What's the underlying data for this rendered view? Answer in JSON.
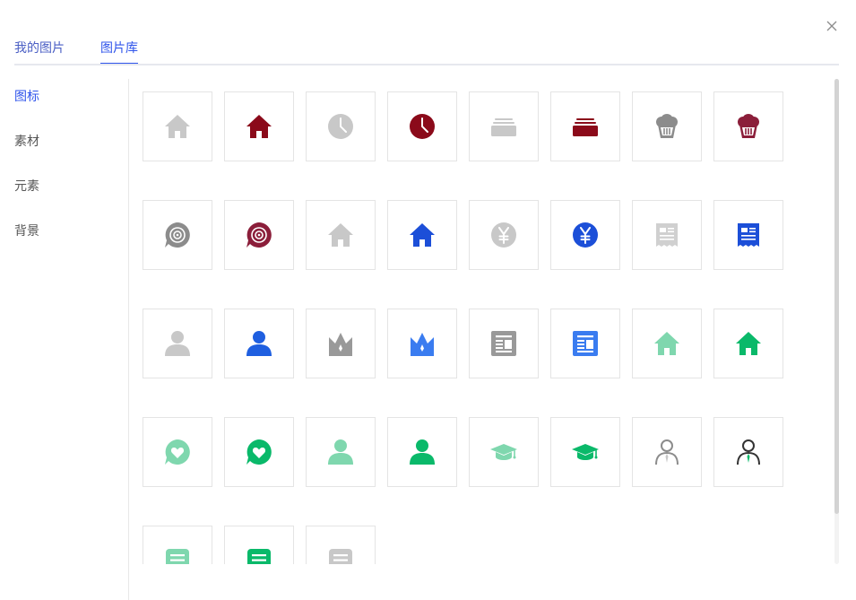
{
  "tabs": {
    "my_images": "我的图片",
    "library": "图片库"
  },
  "sidebar": {
    "items": [
      "图标",
      "素材",
      "元素",
      "背景"
    ]
  },
  "colors": {
    "accent": "#2f54eb",
    "maroon": "#8b0a1a",
    "gray": "#c8c8c8",
    "dark_gray": "#8c8c8c",
    "blue": "#1c4fd8",
    "mint": "#7fd7ae",
    "green": "#0ab96a"
  },
  "icons": [
    {
      "name": "home-icon",
      "color": "#c8c8c8"
    },
    {
      "name": "home-icon",
      "color": "#8b0a1a"
    },
    {
      "name": "clock-icon",
      "color": "#c8c8c8"
    },
    {
      "name": "clock-icon",
      "color": "#8b0a1a"
    },
    {
      "name": "inbox-tray-icon",
      "color": "#c8c8c8"
    },
    {
      "name": "inbox-tray-icon",
      "color": "#8b0a1a"
    },
    {
      "name": "basket-icon",
      "color": "#8c8c8c"
    },
    {
      "name": "basket-icon",
      "color": "#8b1e3a"
    },
    {
      "name": "chat-target-icon",
      "color": "#8c8c8c"
    },
    {
      "name": "chat-target-icon",
      "color": "#8b1e3a"
    },
    {
      "name": "home-icon",
      "color": "#c8c8c8"
    },
    {
      "name": "home-icon",
      "color": "#1c4fd8"
    },
    {
      "name": "yen-icon",
      "color": "#c8c8c8"
    },
    {
      "name": "yen-icon",
      "color": "#1c4fd8"
    },
    {
      "name": "receipt-icon",
      "color": "#d0d0d0"
    },
    {
      "name": "receipt-icon",
      "color": "#1c4fd8"
    },
    {
      "name": "user-icon",
      "color": "#c8c8c8"
    },
    {
      "name": "user-icon",
      "color": "#1f5fe0"
    },
    {
      "name": "crown-icon",
      "color": "#999999"
    },
    {
      "name": "crown-icon",
      "color": "#3a7cf0"
    },
    {
      "name": "news-icon",
      "color": "#999999"
    },
    {
      "name": "news-icon",
      "color": "#3a7cf0"
    },
    {
      "name": "home-icon",
      "color": "#7fd7ae"
    },
    {
      "name": "home-icon",
      "color": "#0ab96a"
    },
    {
      "name": "chat-heart-icon",
      "color": "#7fd7ae"
    },
    {
      "name": "chat-heart-icon",
      "color": "#0ab96a"
    },
    {
      "name": "user-icon",
      "color": "#7fd7ae"
    },
    {
      "name": "user-icon",
      "color": "#0ab96a"
    },
    {
      "name": "graduation-cap-icon",
      "color": "#7fd7ae"
    },
    {
      "name": "graduation-cap-icon",
      "color": "#0ab96a"
    },
    {
      "name": "business-user-icon",
      "color": "#8c8c8c",
      "accent": "#c8c8c8"
    },
    {
      "name": "business-user-icon",
      "color": "#333333",
      "accent": "#0ab96a"
    },
    {
      "name": "document-icon",
      "color": "#7fd7ae"
    },
    {
      "name": "document-icon",
      "color": "#0ab96a"
    },
    {
      "name": "document-icon",
      "color": "#c8c8c8"
    }
  ]
}
